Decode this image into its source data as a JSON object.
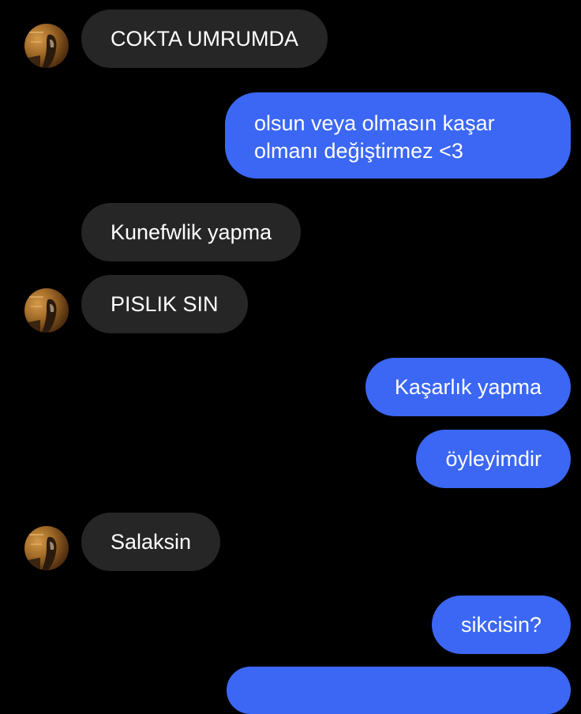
{
  "chat": {
    "messages": [
      {
        "side": "incoming",
        "text": "COKTA UMRUMDA",
        "avatar": true
      },
      {
        "side": "outgoing",
        "text": "olsun veya olmasın kaşar olmanı değiştirmez <3"
      },
      {
        "side": "incoming",
        "text": "Kunefwlik yapma",
        "avatar": false
      },
      {
        "side": "incoming",
        "text": "PISLIK SIN",
        "avatar": true
      },
      {
        "side": "outgoing",
        "text": "Kaşarlık yapma"
      },
      {
        "side": "outgoing",
        "text": "öyleyimdir"
      },
      {
        "side": "incoming",
        "text": "Salaksin",
        "avatar": true
      },
      {
        "side": "outgoing",
        "text": "sikcisin?"
      },
      {
        "side": "outgoing",
        "text": ""
      }
    ]
  },
  "colors": {
    "background": "#000000",
    "incoming_bubble": "#262626",
    "outgoing_bubble": "#3b67f4",
    "text": "#ffffff"
  },
  "icons": {
    "avatar": "contact-avatar-photo"
  }
}
